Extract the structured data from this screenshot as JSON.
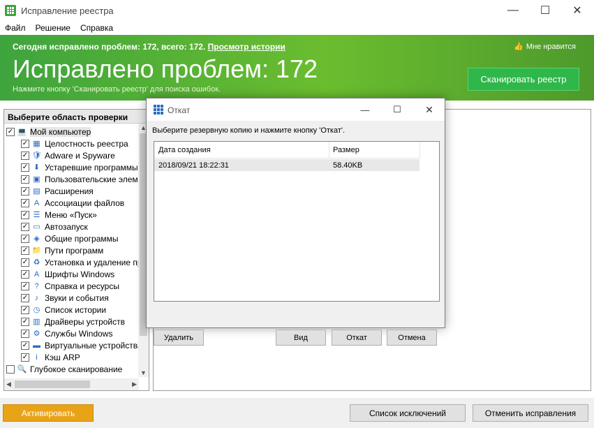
{
  "window": {
    "title": "Исправление реестра"
  },
  "menu": [
    "Файл",
    "Решение",
    "Справка"
  ],
  "banner": {
    "summary_text": "Сегодня исправлено проблем: 172, всего: 172.",
    "history_link": "Просмотр истории",
    "big_text": "Исправлено проблем: 172",
    "hint": "Нажмите кнопку 'Сканировать реестр' для поиска ошибок.",
    "like_label": "Мне нравится",
    "scan_button": "Сканировать реестр"
  },
  "left_panel": {
    "title": "Выберите область проверки",
    "root_label": "Мой компьютер",
    "items": [
      {
        "label": "Целостность реестра",
        "icon": "registry-icon"
      },
      {
        "label": "Adware и Spyware",
        "icon": "spyware-icon"
      },
      {
        "label": "Устаревшие программы",
        "icon": "program-icon"
      },
      {
        "label": "Пользовательские элементы",
        "icon": "user-elements-icon"
      },
      {
        "label": "Расширения",
        "icon": "extensions-icon"
      },
      {
        "label": "Ассоциации файлов",
        "icon": "file-assoc-icon"
      },
      {
        "label": "Меню «Пуск»",
        "icon": "start-menu-icon"
      },
      {
        "label": "Автозапуск",
        "icon": "autostart-icon"
      },
      {
        "label": "Общие программы",
        "icon": "shared-programs-icon"
      },
      {
        "label": "Пути программ",
        "icon": "program-paths-icon"
      },
      {
        "label": "Установка и удаление программ",
        "icon": "install-icon"
      },
      {
        "label": "Шрифты Windows",
        "icon": "fonts-icon"
      },
      {
        "label": "Справка и ресурсы",
        "icon": "help-icon"
      },
      {
        "label": "Звуки и события",
        "icon": "sounds-icon"
      },
      {
        "label": "Список истории",
        "icon": "history-icon"
      },
      {
        "label": "Драйверы устройств",
        "icon": "drivers-icon"
      },
      {
        "label": "Службы Windows",
        "icon": "services-icon"
      },
      {
        "label": "Виртуальные устройства",
        "icon": "virtual-devices-icon"
      },
      {
        "label": "Кэш ARP",
        "icon": "arp-icon"
      }
    ],
    "deep_scan_label": "Глубокое сканирование"
  },
  "bottom": {
    "activate": "Активировать",
    "exclusions": "Список исключений",
    "undo": "Отменить исправления"
  },
  "dialog": {
    "title": "Откат",
    "prompt": "Выберите резервную копию и нажмите кнопку 'Откат'.",
    "columns": [
      "Дата создания",
      "Размер"
    ],
    "rows": [
      {
        "date": "2018/09/21 18:22:31",
        "size": "58.40KB"
      }
    ],
    "buttons": {
      "delete": "Удалить",
      "view": "Вид",
      "rollback": "Откат",
      "cancel": "Отмена"
    }
  },
  "colors": {
    "banner_green": "#4fae35",
    "scan_button": "#2fb74a",
    "activate": "#e8a317"
  }
}
